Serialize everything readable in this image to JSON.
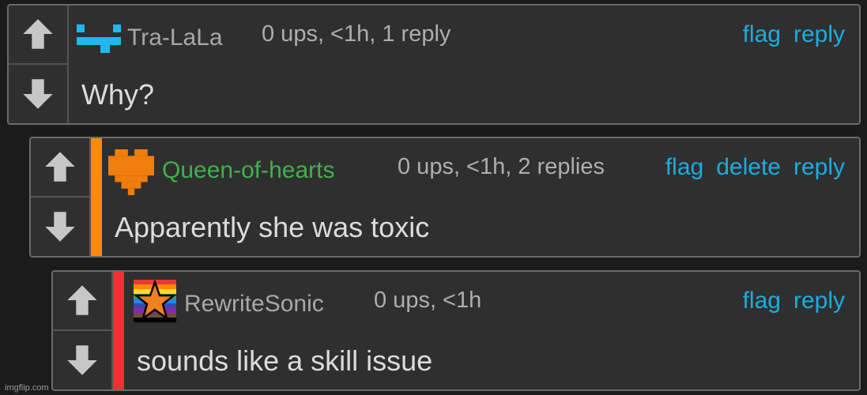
{
  "comments": [
    {
      "username": "Tra-LaLa",
      "meta": "0 ups, <1h, 1 reply",
      "actions": [
        "flag",
        "reply"
      ],
      "text": "Why?"
    },
    {
      "username": "Queen-of-hearts",
      "meta": "0 ups, <1h, 2 replies",
      "actions": [
        "flag",
        "delete",
        "reply"
      ],
      "text": "Apparently she was toxic",
      "thread_color": "#ff8a00"
    },
    {
      "username": "RewriteSonic",
      "meta": "0 ups, <1h",
      "actions": [
        "flag",
        "reply"
      ],
      "text": "sounds like a skill issue",
      "thread_color": "#ee3030"
    }
  ],
  "colors": {
    "link": "#1aaee0",
    "username_default": "#a8a8a8",
    "username_highlight": "#3fb24a"
  },
  "icons": [
    "upvote-arrow-icon",
    "downvote-arrow-icon"
  ],
  "watermark": "imgflip.com"
}
